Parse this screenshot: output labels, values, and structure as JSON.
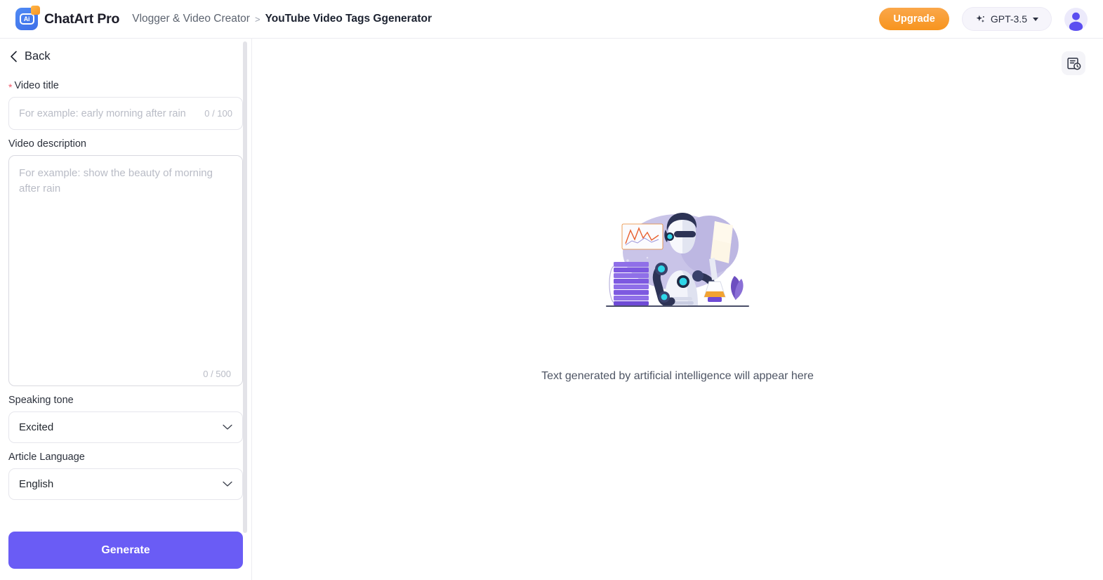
{
  "header": {
    "logo_icon": "chatart-logo-icon",
    "logo_text": "Ai",
    "brand_name": "ChatArt Pro",
    "breadcrumb": {
      "parent": "Vlogger & Video Creator",
      "separator": ">",
      "current": "YouTube Video Tags Ggenerator"
    },
    "upgrade_label": "Upgrade",
    "model_label": "GPT-3.5",
    "model_icon": "sparkle-icon",
    "avatar_icon": "user-avatar-icon",
    "colors": {
      "upgrade_orange": "#f7941e",
      "brand_blue": "#4f8bf5",
      "accent_purple": "#6a5cf5"
    }
  },
  "sidebar": {
    "back_label": "Back",
    "fields": {
      "video_title": {
        "label": "Video title",
        "required_marker": "*",
        "placeholder": "For example: early morning after rain",
        "value": "",
        "counter": "0 / 100"
      },
      "video_description": {
        "label": "Video description",
        "placeholder": "For example: show the beauty of morning after rain",
        "value": "",
        "counter": "0 / 500"
      },
      "speaking_tone": {
        "label": "Speaking tone",
        "value": "Excited"
      },
      "article_language": {
        "label": "Article Language",
        "value": "English"
      }
    },
    "generate_label": "Generate"
  },
  "main": {
    "history_icon": "history-document-clock-icon",
    "empty_text": "Text generated by artificial intelligence will appear here",
    "illustration": "ai-robot-illustration"
  }
}
